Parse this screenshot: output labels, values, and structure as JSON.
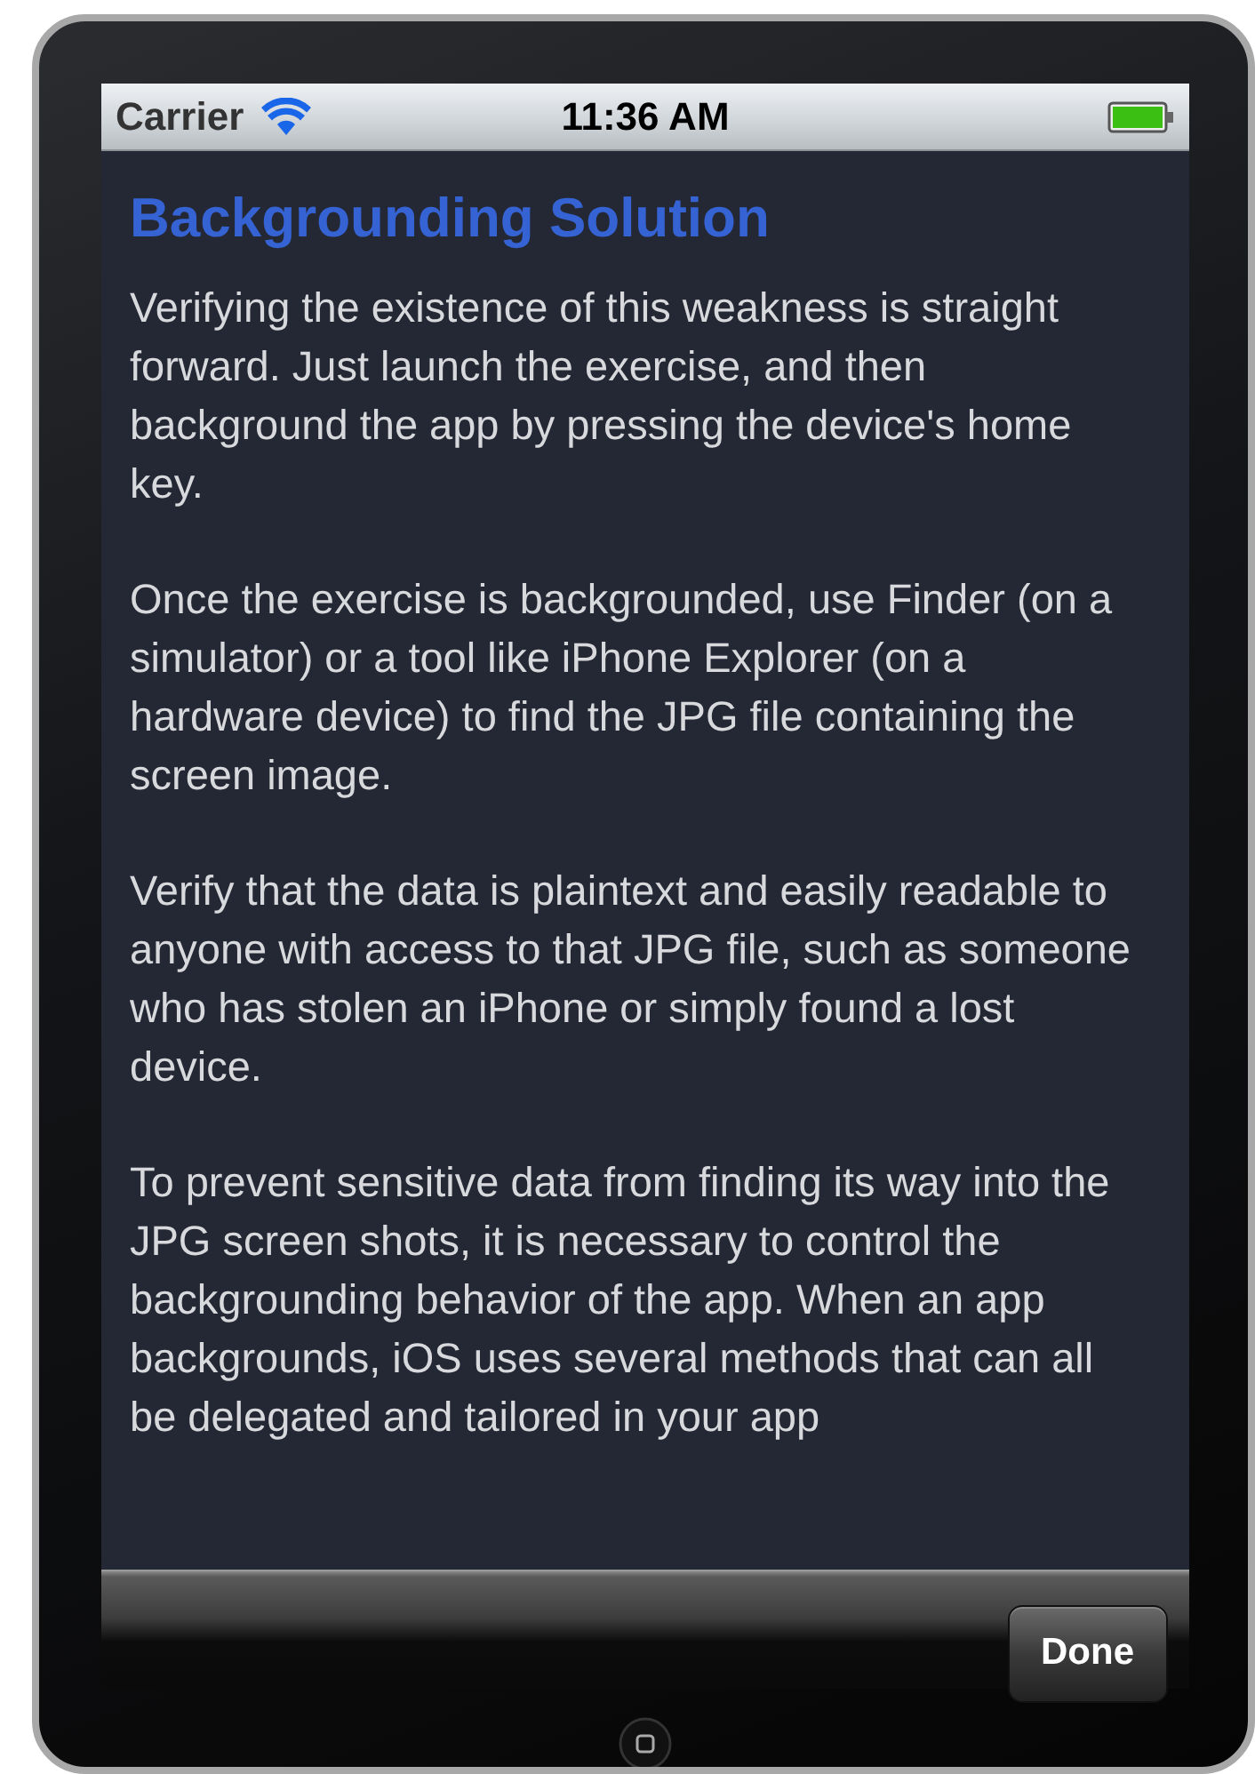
{
  "status_bar": {
    "carrier": "Carrier",
    "time": "11:36 AM"
  },
  "article": {
    "title": "Backgrounding Solution",
    "paragraphs": [
      "Verifying the existence of this weakness is straight forward. Just launch the exercise, and then background the app by pressing the device's home key.",
      "Once the exercise is backgrounded, use Finder (on a simulator) or a tool like iPhone Explorer (on a hardware device) to find the JPG file containing the screen image.",
      "Verify that the data is plaintext and easily readable to anyone with access to that JPG file, such as someone who has stolen an iPhone or simply found a lost device.",
      "To prevent sensitive data from finding its way into the JPG screen shots, it is necessary to control the backgrounding behavior of the app. When an app backgrounds, iOS uses several methods that can all be delegated and tailored in your app"
    ]
  },
  "toolbar": {
    "buttons": [
      "Done"
    ]
  }
}
